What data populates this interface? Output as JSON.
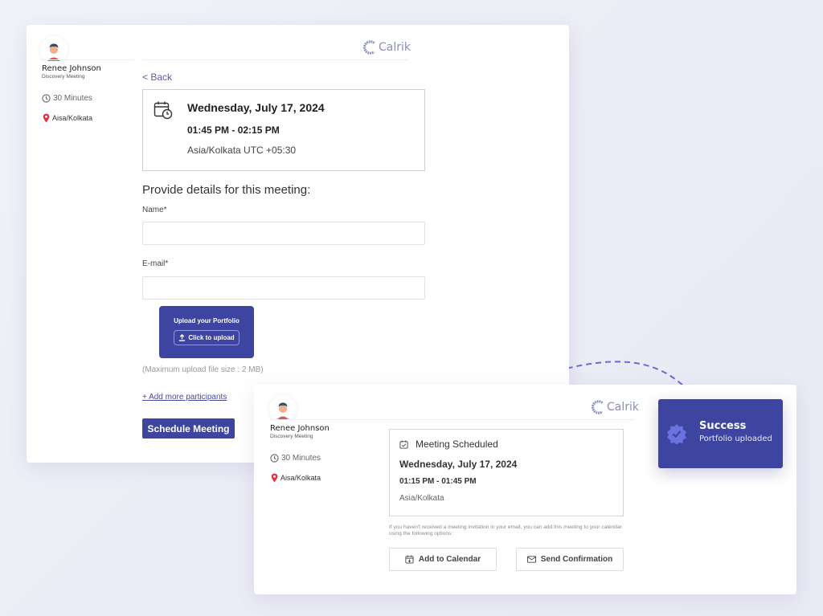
{
  "brand": {
    "name": "Calrik",
    "accent_color": "#3e45a0",
    "connector_color": "#6a6ad8"
  },
  "booking_form": {
    "host": {
      "name": "Renee Johnson",
      "meeting_type": "Discovery Meeting",
      "duration": "30 Minutes",
      "location": "Aisa/Kolkata"
    },
    "back_label": "< Back",
    "event": {
      "date": "Wednesday, July 17, 2024",
      "time": "01:45 PM - 02:15 PM",
      "timezone": "Asia/Kolkata UTC +05:30"
    },
    "heading": "Provide details for this meeting:",
    "fields": {
      "name": {
        "label": "Name*",
        "value": "",
        "placeholder": ""
      },
      "email": {
        "label": "E-mail*",
        "value": "",
        "placeholder": ""
      }
    },
    "upload": {
      "title": "Upload your Portfolio",
      "button_label": "Click to upload",
      "hint": "(Maximum upload file size : 2 MB)"
    },
    "add_participants_label": "+ Add more participants",
    "submit_label": "Schedule Meeting"
  },
  "confirmation": {
    "host": {
      "name": "Renee Johnson",
      "meeting_type": "Discovery Meeting",
      "duration": "30 Minutes",
      "location": "Aisa/Kolkata"
    },
    "title": "Meeting Scheduled",
    "date": "Wednesday, July 17, 2024",
    "time": "01:15 PM - 01:45 PM",
    "timezone": "Asia/Kolkata",
    "note": "If you haven't received a meeting invitation in your email, you can add this meeting to your calendar using the following options:",
    "actions": {
      "add_to_calendar": "Add to Calendar",
      "send_confirmation": "Send Confirmation"
    }
  },
  "toast": {
    "title": "Success",
    "message": "Portfolio uploaded"
  }
}
